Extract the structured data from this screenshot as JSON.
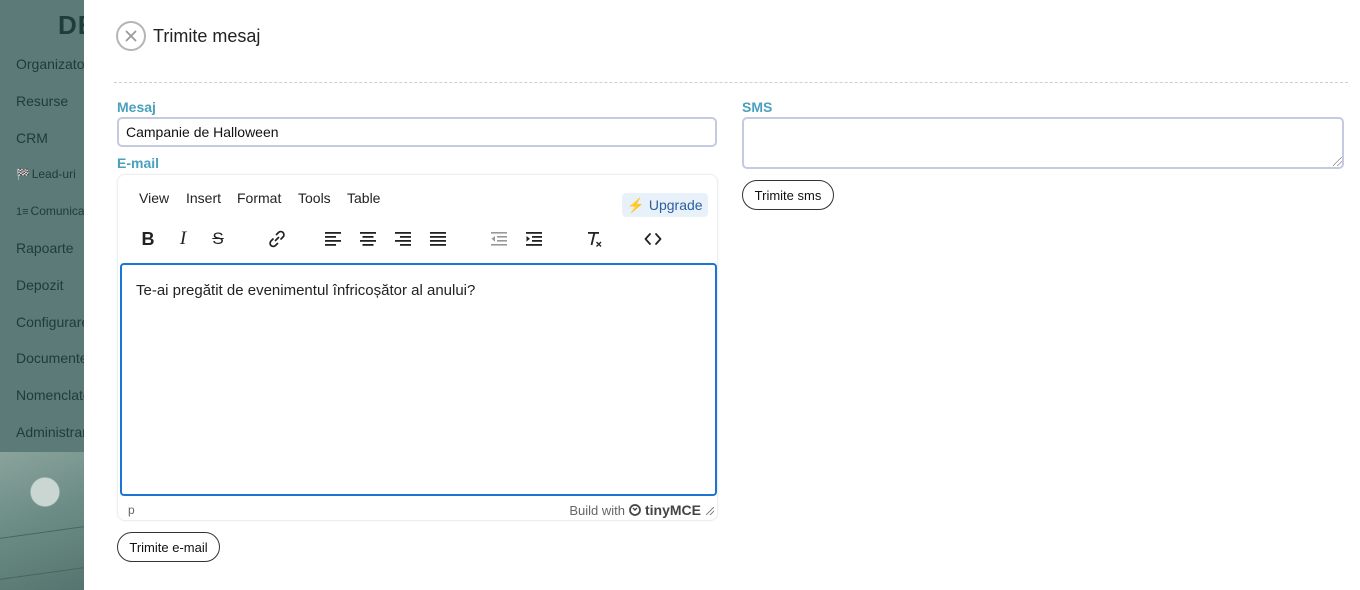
{
  "background": {
    "logo_text": "DE",
    "menu_items": [
      {
        "label": "Organizator",
        "icon": "",
        "small": false
      },
      {
        "label": "Resurse",
        "icon": "",
        "small": false
      },
      {
        "label": "CRM",
        "icon": "",
        "small": false
      },
      {
        "label": "Lead-uri",
        "icon": "🏁",
        "small": true
      },
      {
        "label": "Comunicare",
        "icon": "1≡",
        "small": true
      },
      {
        "label": "Rapoarte",
        "icon": "",
        "small": false
      },
      {
        "label": "Depozit",
        "icon": "",
        "small": false
      },
      {
        "label": "Configurare",
        "icon": "",
        "small": false
      },
      {
        "label": "Documente",
        "icon": "",
        "small": false
      },
      {
        "label": "Nomenclatoare",
        "icon": "",
        "small": false
      },
      {
        "label": "Administrare",
        "icon": "",
        "small": false
      }
    ]
  },
  "modal": {
    "title": "Trimite mesaj",
    "close_icon": "close-icon"
  },
  "message": {
    "label": "Mesaj",
    "value": "Campanie de Halloween"
  },
  "email": {
    "label": "E-mail",
    "send_label": "Trimite e-mail"
  },
  "editor": {
    "menus": [
      "View",
      "Insert",
      "Format",
      "Tools",
      "Table"
    ],
    "upgrade_label": "Upgrade",
    "toolbar": [
      "bold",
      "italic",
      "strikethrough",
      "link",
      "align-left",
      "align-center",
      "align-right",
      "align-justify",
      "outdent",
      "indent",
      "clear-formatting",
      "source-code"
    ],
    "content": "Te-ai pregătit de evenimentul înfricoșător al anului?",
    "status_path": "p",
    "branding_prefix": "Build with",
    "branding_name": "tinyMCE"
  },
  "sms": {
    "label": "SMS",
    "value": "",
    "send_label": "Trimite sms"
  },
  "colors": {
    "label_blue": "#4aa0bd",
    "focus_blue": "#1c74d4",
    "upgrade_bg": "#e8f1fa",
    "upgrade_bolt": "#f26b21"
  }
}
